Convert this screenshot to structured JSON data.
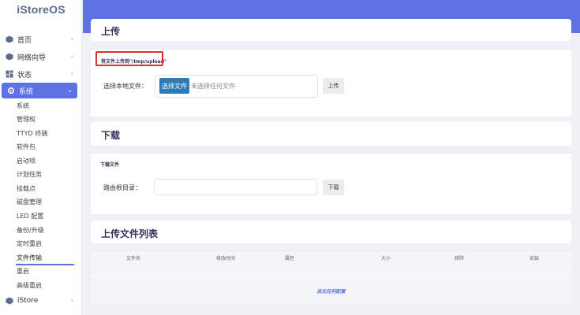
{
  "brand": "iStoreOS",
  "nav": {
    "home": "首页",
    "wizard": "网络向导",
    "status": "状态",
    "system": "系统",
    "istore": "iStore"
  },
  "system_menu": [
    "系统",
    "管理权",
    "TTYD 终端",
    "软件包",
    "启动项",
    "计划任务",
    "挂载点",
    "磁盘管理",
    "LED 配置",
    "备份/升级",
    "定时重启",
    "文件传输",
    "重启",
    "高级重启"
  ],
  "upload": {
    "title": "上传",
    "section_label": "将文件上传到\"/tmp/upload\"",
    "field_label": "选择本地文件：",
    "choose_button": "选择文件",
    "no_file_text": "未选择任何文件",
    "upload_button": "上传"
  },
  "download": {
    "title": "下载",
    "section_label": "下载文件",
    "field_label": "路由根目录：",
    "input_value": "",
    "download_button": "下载"
  },
  "file_list": {
    "title": "上传文件列表",
    "columns": [
      "文件名",
      "修改时间",
      "属性",
      "大小",
      "移除",
      "安装"
    ],
    "empty_text": "尚无任何配置"
  },
  "colors": {
    "accent": "#5e72e4",
    "choose_button": "#2c7bb8",
    "highlight": "#e03131"
  }
}
